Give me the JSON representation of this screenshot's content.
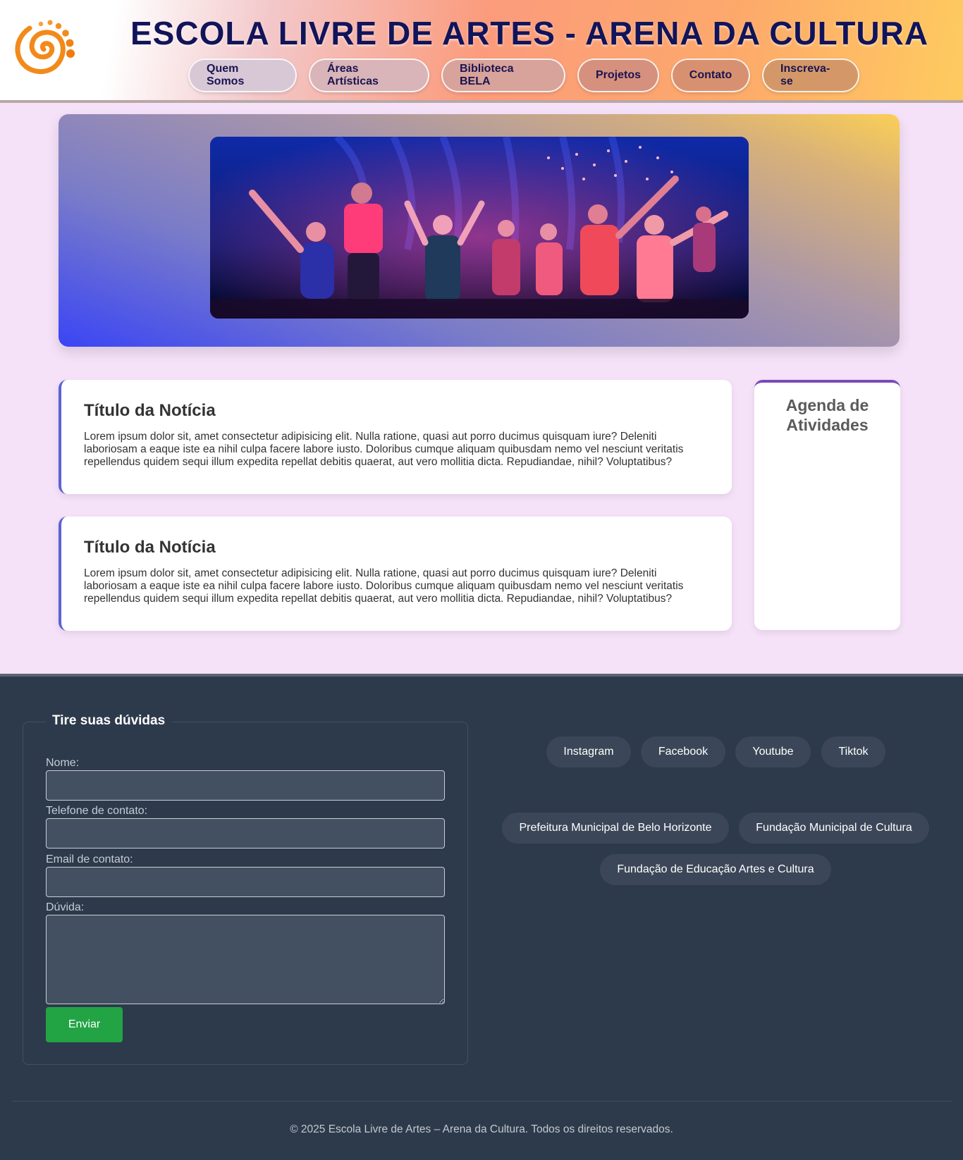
{
  "header": {
    "title": "ESCOLA LIVRE DE ARTES - ARENA DA CULTURA",
    "logo_icon": "spiral-logo-icon",
    "nav": [
      {
        "label": "Quem Somos"
      },
      {
        "label": "Áreas Artísticas"
      },
      {
        "label": "Biblioteca BELA"
      },
      {
        "label": "Projetos"
      },
      {
        "label": "Contato"
      },
      {
        "label": "Inscreva-se"
      }
    ]
  },
  "hero": {
    "image": "stage-performance-photo"
  },
  "news": [
    {
      "title": "Título da Notícia",
      "body": "Lorem ipsum dolor sit, amet consectetur adipisicing elit. Nulla ratione, quasi aut porro ducimus quisquam iure? Deleniti laboriosam a eaque iste ea nihil culpa facere labore iusto. Doloribus cumque aliquam quibusdam nemo vel nesciunt veritatis repellendus quidem sequi illum expedita repellat debitis quaerat, aut vero mollitia dicta. Repudiandae, nihil? Voluptatibus?"
    },
    {
      "title": "Título da Notícia",
      "body": "Lorem ipsum dolor sit, amet consectetur adipisicing elit. Nulla ratione, quasi aut porro ducimus quisquam iure? Deleniti laboriosam a eaque iste ea nihil culpa facere labore iusto. Doloribus cumque aliquam quibusdam nemo vel nesciunt veritatis repellendus quidem sequi illum expedita repellat debitis quaerat, aut vero mollitia dicta. Repudiandae, nihil? Voluptatibus?"
    }
  ],
  "agenda": {
    "title": "Agenda de Atividades"
  },
  "contact_form": {
    "legend": "Tire suas dúvidas",
    "fields": [
      {
        "label": "Nome:",
        "value": ""
      },
      {
        "label": "Telefone de contato:",
        "value": ""
      },
      {
        "label": "Email de contato:",
        "value": ""
      },
      {
        "label": "Dúvida:",
        "value": ""
      }
    ],
    "submit_label": "Enviar"
  },
  "social_links": [
    {
      "label": "Instagram"
    },
    {
      "label": "Facebook"
    },
    {
      "label": "Youtube"
    },
    {
      "label": "Tiktok"
    }
  ],
  "partner_links": [
    {
      "label": "Prefeitura Municipal de Belo Horizonte"
    },
    {
      "label": "Fundação Municipal de Cultura"
    },
    {
      "label": "Fundação de Educação Artes e Cultura"
    }
  ],
  "footer": {
    "copyright": "© 2025 Escola Livre de Artes – Arena da Cultura. Todos os direitos reservados."
  },
  "colors": {
    "title": "#12145a",
    "footer_bg": "#2d3a4b",
    "submit": "#22a444",
    "page_bg": "#f5e1f8"
  }
}
